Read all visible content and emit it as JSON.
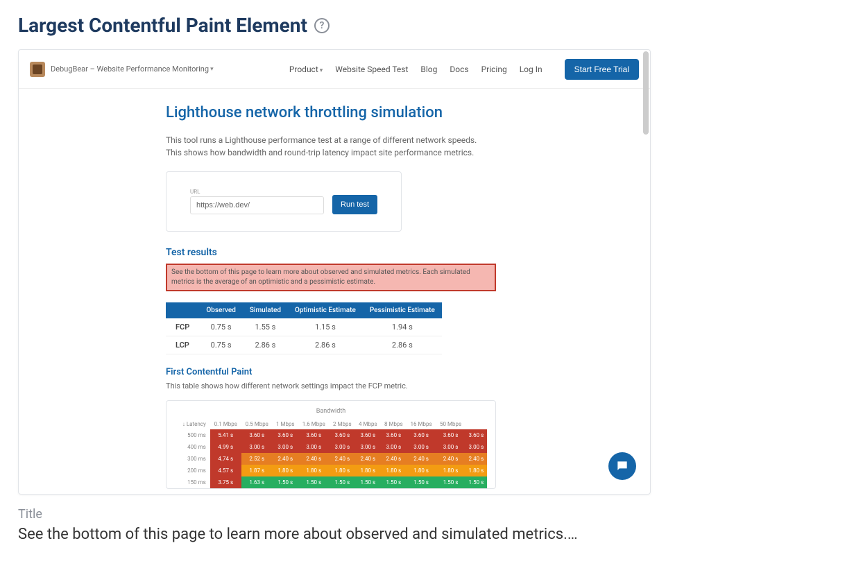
{
  "section_title": "Largest Contentful Paint Element",
  "nav": {
    "brand": "DebugBear – Website Performance Monitoring",
    "items": [
      "Product",
      "Website Speed Test",
      "Blog",
      "Docs",
      "Pricing",
      "Log In"
    ],
    "cta": "Start Free Trial"
  },
  "page": {
    "h1": "Lighthouse network throttling simulation",
    "desc": "This tool runs a Lighthouse performance test at a range of different network speeds. This shows how bandwidth and round-trip latency impact site performance metrics.",
    "url_label": "URL",
    "url_value": "https://web.dev/",
    "run_btn": "Run test",
    "results_h": "Test results",
    "highlight": "See the bottom of this page to learn more about observed and simulated metrics. Each simulated metrics is the average of an optimistic and a pessimistic estimate.",
    "table": {
      "headers": [
        "",
        "Observed",
        "Simulated",
        "Optimistic Estimate",
        "Pessimistic Estimate"
      ],
      "rows": [
        {
          "label": "FCP",
          "vals": [
            "0.75 s",
            "1.55 s",
            "1.15 s",
            "1.94 s"
          ]
        },
        {
          "label": "LCP",
          "vals": [
            "0.75 s",
            "2.86 s",
            "2.86 s",
            "2.86 s"
          ]
        }
      ]
    },
    "fcp_h": "First Contentful Paint",
    "fcp_desc": "This table shows how different network settings impact the FCP metric.",
    "bandwidth_label": "Bandwidth",
    "heat": {
      "cols": [
        "0.1 Mbps",
        "0.5 Mbps",
        "1 Mbps",
        "1.6 Mbps",
        "2 Mbps",
        "4 Mbps",
        "8 Mbps",
        "16 Mbps",
        "50 Mbps"
      ],
      "axis": "↓ Latency",
      "rows": [
        {
          "lat": "500 ms",
          "cells": [
            {
              "v": "5.41 s",
              "c": "r"
            },
            {
              "v": "3.60 s",
              "c": "r"
            },
            {
              "v": "3.60 s",
              "c": "r"
            },
            {
              "v": "3.60 s",
              "c": "r"
            },
            {
              "v": "3.60 s",
              "c": "r"
            },
            {
              "v": "3.60 s",
              "c": "r"
            },
            {
              "v": "3.60 s",
              "c": "r"
            },
            {
              "v": "3.60 s",
              "c": "r"
            },
            {
              "v": "3.60 s",
              "c": "r"
            },
            {
              "v": "3.60 s",
              "c": "r"
            }
          ]
        },
        {
          "lat": "400 ms",
          "cells": [
            {
              "v": "4.99 s",
              "c": "r"
            },
            {
              "v": "3.00 s",
              "c": "r"
            },
            {
              "v": "3.00 s",
              "c": "r"
            },
            {
              "v": "3.00 s",
              "c": "r"
            },
            {
              "v": "3.00 s",
              "c": "r"
            },
            {
              "v": "3.00 s",
              "c": "r"
            },
            {
              "v": "3.00 s",
              "c": "r"
            },
            {
              "v": "3.00 s",
              "c": "r"
            },
            {
              "v": "3.00 s",
              "c": "r"
            },
            {
              "v": "3.00 s",
              "c": "r"
            }
          ]
        },
        {
          "lat": "300 ms",
          "cells": [
            {
              "v": "4.74 s",
              "c": "r"
            },
            {
              "v": "2.52 s",
              "c": "o"
            },
            {
              "v": "2.40 s",
              "c": "o"
            },
            {
              "v": "2.40 s",
              "c": "o"
            },
            {
              "v": "2.40 s",
              "c": "o"
            },
            {
              "v": "2.40 s",
              "c": "o"
            },
            {
              "v": "2.40 s",
              "c": "o"
            },
            {
              "v": "2.40 s",
              "c": "o"
            },
            {
              "v": "2.40 s",
              "c": "o"
            },
            {
              "v": "2.40 s",
              "c": "o"
            }
          ]
        },
        {
          "lat": "200 ms",
          "cells": [
            {
              "v": "4.57 s",
              "c": "r"
            },
            {
              "v": "1.87 s",
              "c": "y"
            },
            {
              "v": "1.80 s",
              "c": "y"
            },
            {
              "v": "1.80 s",
              "c": "y"
            },
            {
              "v": "1.80 s",
              "c": "y"
            },
            {
              "v": "1.80 s",
              "c": "y"
            },
            {
              "v": "1.80 s",
              "c": "y"
            },
            {
              "v": "1.80 s",
              "c": "y"
            },
            {
              "v": "1.80 s",
              "c": "y"
            },
            {
              "v": "1.80 s",
              "c": "y"
            }
          ]
        },
        {
          "lat": "150 ms",
          "cells": [
            {
              "v": "3.75 s",
              "c": "r"
            },
            {
              "v": "1.63 s",
              "c": "g"
            },
            {
              "v": "1.50 s",
              "c": "g"
            },
            {
              "v": "1.50 s",
              "c": "g"
            },
            {
              "v": "1.50 s",
              "c": "g"
            },
            {
              "v": "1.50 s",
              "c": "g"
            },
            {
              "v": "1.50 s",
              "c": "g"
            },
            {
              "v": "1.50 s",
              "c": "g"
            },
            {
              "v": "1.50 s",
              "c": "g"
            },
            {
              "v": "1.50 s",
              "c": "g"
            }
          ]
        }
      ]
    }
  },
  "meta": {
    "label": "Title",
    "text": "See the bottom of this page to learn more about observed and simulated metrics.…"
  }
}
